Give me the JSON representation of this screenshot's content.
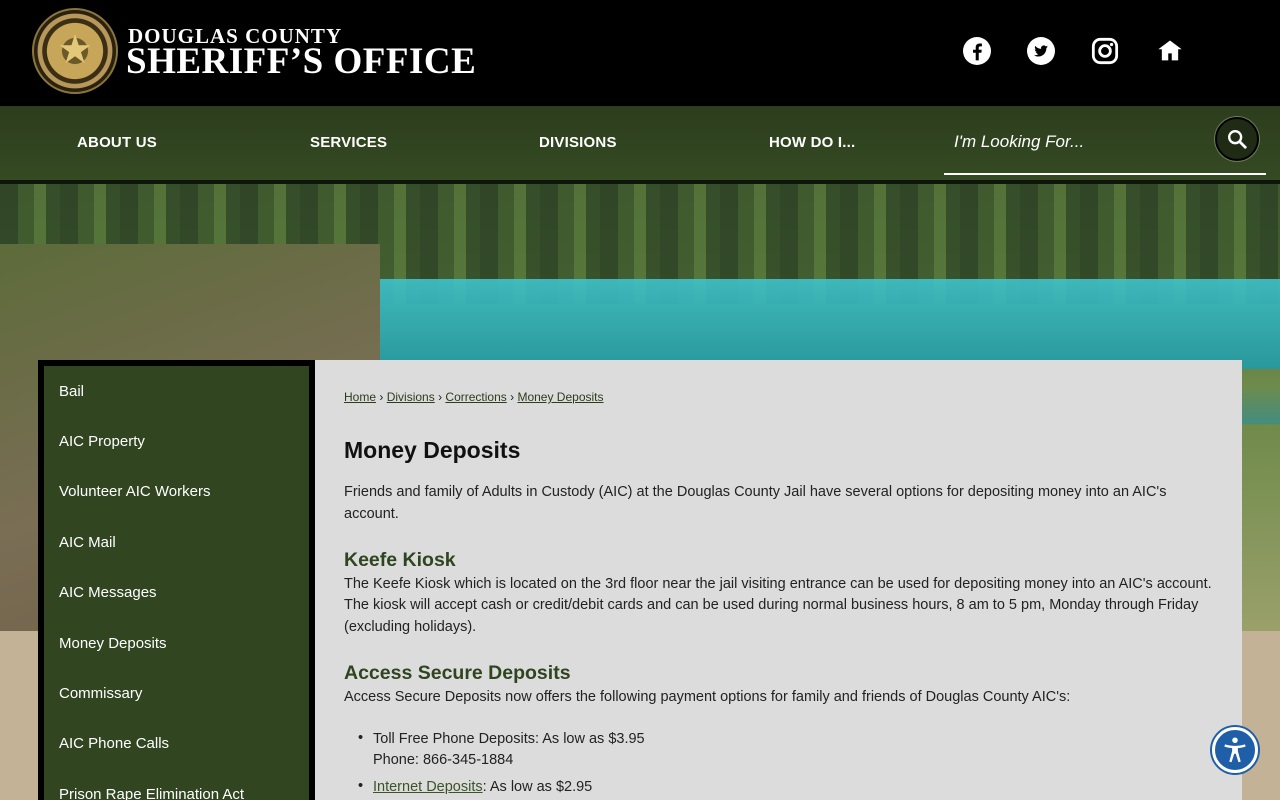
{
  "header": {
    "logo_small": "DOUGLAS COUNTY",
    "logo_big": "SHERIFF’S OFFICE",
    "social": [
      {
        "icon": "facebook-icon"
      },
      {
        "icon": "twitter-icon"
      },
      {
        "icon": "instagram-icon"
      },
      {
        "icon": "nextdoor-icon"
      }
    ]
  },
  "nav": {
    "items": [
      "ABOUT US",
      "SERVICES",
      "DIVISIONS",
      "HOW DO I..."
    ],
    "search_placeholder": "I'm Looking For..."
  },
  "sidebar": {
    "items": [
      "Bail",
      "AIC Property",
      "Volunteer AIC Workers",
      "AIC Mail",
      "AIC Messages",
      "Money Deposits",
      "Commissary",
      "AIC Phone Calls",
      "Prison Rape Elimination Act"
    ]
  },
  "breadcrumb": {
    "items": [
      "Home",
      "Divisions",
      "Corrections",
      "Money Deposits"
    ],
    "separator": "›"
  },
  "main": {
    "title": "Money Deposits",
    "intro_line1": "Friends and family of Adults in Custody (AIC) at the Douglas County Jail have several options for depositing money into an AIC's",
    "intro_line2": "account.",
    "section1": {
      "heading": "Keefe Kiosk",
      "line1": "The Keefe Kiosk which is located on the 3rd floor near the jail visiting entrance can be used for depositing money into an AIC's account.",
      "line2": "The kiosk will accept cash or credit/debit cards and can be used during normal business hours, 8 am to 5 pm, Monday through Friday",
      "line3": "(excluding holidays)."
    },
    "section2": {
      "heading": "Access Secure Deposits",
      "intro": "Access Secure Deposits now offers the following payment options for family and friends of Douglas County AIC's:",
      "bullets": [
        {
          "line1": "Toll Free Phone Deposits: As low as $3.95",
          "line2": "Phone: 866-345-1884"
        },
        {
          "link": "Internet Deposits",
          "rest": ": As low as $2.95"
        }
      ]
    }
  },
  "colors": {
    "nav_green": "#354a23",
    "sidebar_green": "#314521",
    "heading_green": "#2f4520",
    "accessibility_blue": "#1e5fa8"
  }
}
